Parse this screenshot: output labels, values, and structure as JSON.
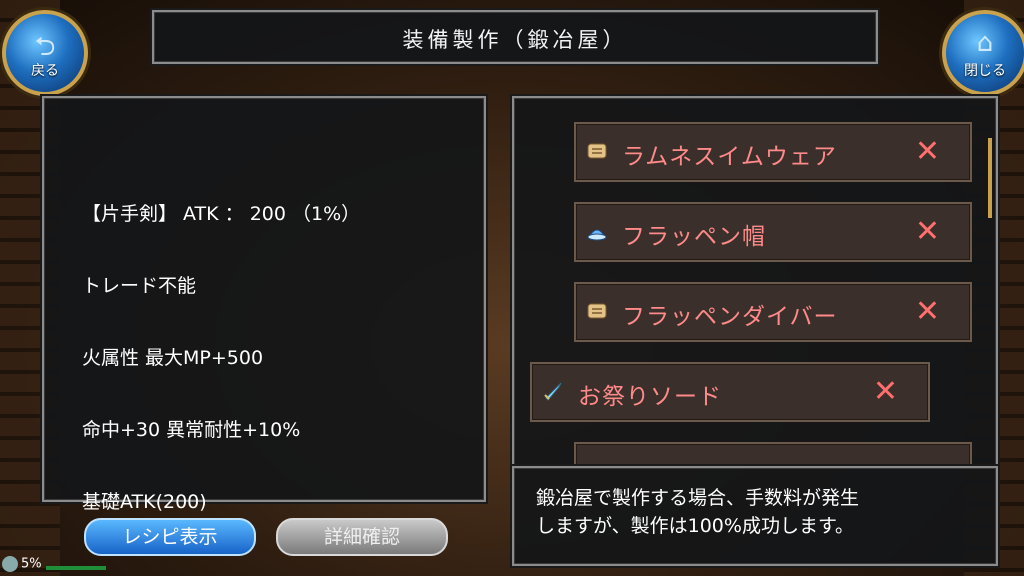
{
  "header": {
    "title": "装備製作（鍛冶屋）",
    "back_label": "戻る",
    "close_label": "閉じる"
  },
  "info": {
    "lines": [
      "【片手剣】 ATK ： 200 （1%）",
      "トレード不能",
      "火属性 最大MP+500",
      "命中+30 異常耐性+10%",
      "基礎ATK(200)"
    ]
  },
  "recipe_list": {
    "items": [
      {
        "name": "ラムネスイムウェア",
        "icon": "armor-icon",
        "remove": "✕"
      },
      {
        "name": "フラッペン帽",
        "icon": "hat-icon",
        "remove": "✕"
      },
      {
        "name": "フラッペンダイバー",
        "icon": "armor-icon",
        "remove": "✕"
      },
      {
        "name": "お祭りソード",
        "icon": "sword-icon",
        "remove": "✕"
      }
    ]
  },
  "message": {
    "line1": "鍛冶屋で製作する場合、手数料が発生",
    "line2": "しますが、製作は100%成功します。"
  },
  "buttons": {
    "recipe_label": "レシピ表示",
    "detail_label": "詳細確認"
  },
  "status": {
    "percent": "5%",
    "progress": 0.05
  },
  "colors": {
    "accent_blue": "#1e6fc0",
    "item_name": "#ff8a8a",
    "remove": "#ff6f6f"
  }
}
